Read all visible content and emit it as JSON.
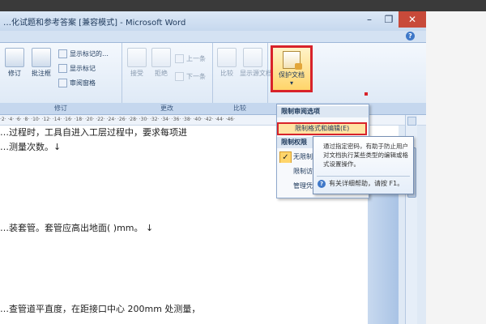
{
  "window": {
    "title": "…化试题和参考答案 [兼容模式] - Microsoft Word",
    "help_glyph": "?",
    "controls": {
      "minimize": "–",
      "restore": "❐",
      "close": "✕"
    }
  },
  "ribbon": {
    "groups": [
      {
        "label": "修订",
        "buttons": [
          "修订",
          "批注框"
        ],
        "small_buttons": [
          "显示标记的…",
          "显示标记",
          "审阅窗格"
        ]
      },
      {
        "label": "更改",
        "buttons": [
          "接受",
          "拒绝"
        ],
        "small_buttons": [
          "上一条",
          "下一条"
        ]
      },
      {
        "label": "比较",
        "buttons": [
          "比较",
          "显示源文档"
        ]
      },
      {
        "label": "",
        "buttons": [
          "保护文档"
        ]
      }
    ]
  },
  "menu": {
    "sections": [
      {
        "header": "限制审阅选项"
      },
      {
        "item": "限制格式和编辑(E)"
      },
      {
        "header": "限制权限"
      },
      {
        "item": "无限制访问",
        "checked": true
      },
      {
        "item": "限制访问"
      },
      {
        "item": "管理凭据"
      }
    ]
  },
  "tooltip": {
    "text": "通过指定密码，有助于防止用户对文档执行某些类型的编辑或格式设置操作。",
    "help": "有关详细帮助，请按 F1。"
  },
  "ruler": {
    "ticks": "·2· ·4· ·6· ·8· ·10· ·12· ·14· ·16· ·18· ·20· ·22· ·24· ·26· ·28· ·30· ·32· ·34· ·36· ·38· ·40· ·42· ·44· ·46·"
  },
  "document": {
    "lines": [
      "…过程时，工具自进入工层过程中，要求每项进",
      "…测量次数。↓",
      "…装套管。套管应高出地面(   )mm。 ↓",
      "…查管道平直度，在距接口中心 200mm 处测量，"
    ]
  },
  "colors": {
    "highlight_border": "#d8232a",
    "ribbon_bg": "#dbe7f5",
    "menu_hover": "#ffe3a3"
  }
}
